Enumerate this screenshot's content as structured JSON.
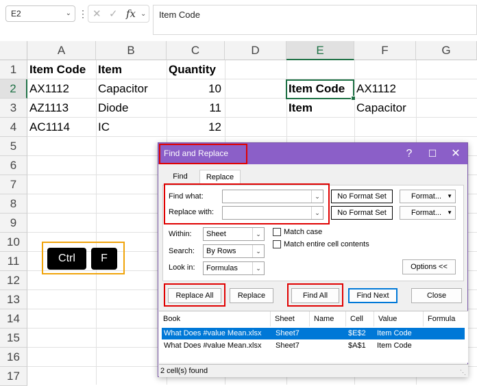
{
  "formula_bar": {
    "name_box": "E2",
    "formula": "Item Code"
  },
  "columns": [
    "A",
    "B",
    "C",
    "D",
    "E",
    "F",
    "G"
  ],
  "rows": [
    "1",
    "2",
    "3",
    "4",
    "5",
    "6",
    "7",
    "8",
    "9",
    "10",
    "11",
    "12",
    "13",
    "14",
    "15",
    "16",
    "17"
  ],
  "cells": {
    "A1": "Item Code",
    "B1": "Item",
    "C1": "Quantity",
    "A2": "AX1112",
    "B2": "Capacitor",
    "C2": "10",
    "A3": "AZ1113",
    "B3": "Diode",
    "C3": "11",
    "A4": "AC1114",
    "B4": "IC",
    "C4": "12",
    "E2": "Item Code",
    "F2": "AX1112",
    "E3": "Item",
    "F3": "Capacitor"
  },
  "keys": {
    "ctrl": "Ctrl",
    "f": "F"
  },
  "dialog": {
    "title": "Find and Replace",
    "tabs": {
      "find": "Find",
      "replace": "Replace"
    },
    "find_what_label": "Find what:",
    "replace_with_label": "Replace with:",
    "find_what_value": "",
    "replace_with_value": "",
    "no_format_1": "No Format Set",
    "no_format_2": "No Format Set",
    "format_1": "Format...",
    "format_2": "Format...",
    "within_label": "Within:",
    "within_value": "Sheet",
    "search_label": "Search:",
    "search_value": "By Rows",
    "lookin_label": "Look in:",
    "lookin_value": "Formulas",
    "match_case": "Match case",
    "match_entire": "Match entire cell contents",
    "options_button": "Options <<",
    "replace_all": "Replace All",
    "replace": "Replace",
    "find_all": "Find All",
    "find_next": "Find Next",
    "close": "Close",
    "result_headers": {
      "book": "Book",
      "sheet": "Sheet",
      "name": "Name",
      "cell": "Cell",
      "value": "Value",
      "formula": "Formula"
    },
    "results": [
      {
        "book": "What Does #value Mean.xlsx",
        "sheet": "Sheet7",
        "name": "",
        "cell": "$E$2",
        "value": "Item Code",
        "formula": ""
      },
      {
        "book": "What Does #value Mean.xlsx",
        "sheet": "Sheet7",
        "name": "",
        "cell": "$A$1",
        "value": "Item Code",
        "formula": ""
      }
    ],
    "status": "2 cell(s) found"
  },
  "colors": {
    "title_bar": "#8b5fc8",
    "highlight_red": "#e00000",
    "key_box": "#f0a30a",
    "selection_blue": "#0078d7",
    "excel_green": "#1e7145"
  }
}
